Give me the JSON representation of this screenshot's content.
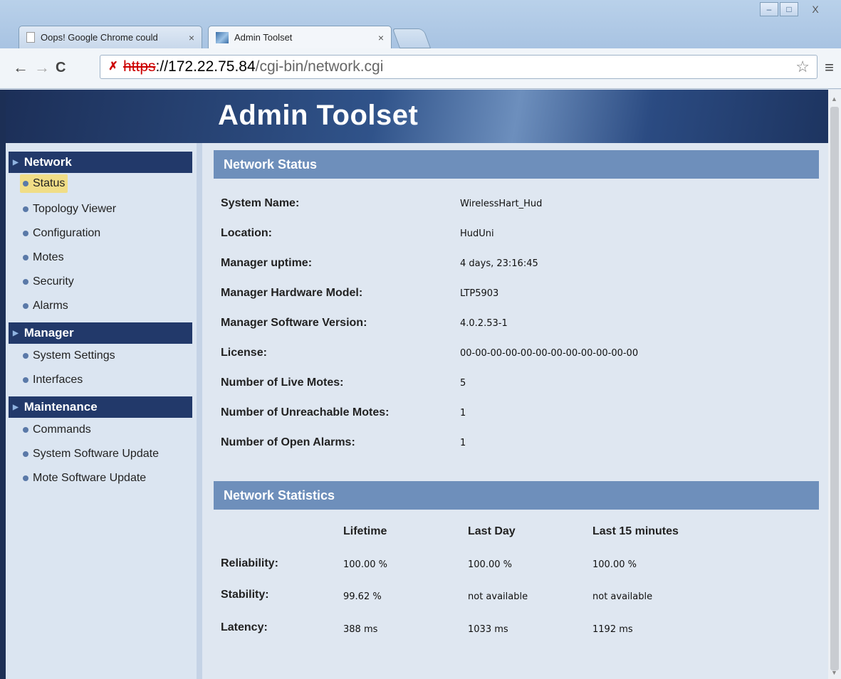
{
  "browser": {
    "tabs": [
      {
        "title": "Oops! Google Chrome could",
        "close": "×"
      },
      {
        "title": "Admin Toolset",
        "close": "×"
      }
    ],
    "window_buttons": {
      "minimize": "–",
      "maximize": "□",
      "close": "X"
    },
    "url": {
      "scheme": "https",
      "rest_host": "://172.22.75.84",
      "path": "/cgi-bin/network.cgi"
    }
  },
  "header": {
    "title": "Admin Toolset"
  },
  "sidebar": {
    "sections": [
      {
        "title": "Network",
        "items": [
          "Status",
          "Topology Viewer",
          "Configuration",
          "Motes",
          "Security",
          "Alarms"
        ]
      },
      {
        "title": "Manager",
        "items": [
          "System Settings",
          "Interfaces"
        ]
      },
      {
        "title": "Maintenance",
        "items": [
          "Commands",
          "System Software Update",
          "Mote Software Update"
        ]
      }
    ],
    "active_item": "Status"
  },
  "status_panel": {
    "title": "Network Status",
    "rows": [
      {
        "label": "System Name:",
        "value": "WirelessHart_Hud"
      },
      {
        "label": "Location:",
        "value": "HudUni"
      },
      {
        "label": "Manager uptime:",
        "value": "4 days, 23:16:45"
      },
      {
        "label": "Manager Hardware Model:",
        "value": "LTP5903"
      },
      {
        "label": "Manager Software Version:",
        "value": "4.0.2.53-1"
      },
      {
        "label": "License:",
        "value": "00-00-00-00-00-00-00-00-00-00-00-00"
      },
      {
        "label": "Number of Live Motes:",
        "value": "5"
      },
      {
        "label": "Number of Unreachable Motes:",
        "value": "1"
      },
      {
        "label": "Number of Open Alarms:",
        "value": "1"
      }
    ]
  },
  "stats_panel": {
    "title": "Network Statistics",
    "columns": [
      "Lifetime",
      "Last Day",
      "Last 15 minutes"
    ],
    "rows": [
      {
        "label": "Reliability:",
        "values": [
          "100.00 %",
          "100.00 %",
          "100.00 %"
        ]
      },
      {
        "label": "Stability:",
        "values": [
          "99.62 %",
          "not available",
          "not available"
        ]
      },
      {
        "label": "Latency:",
        "values": [
          "388 ms",
          "1033 ms",
          "1192 ms"
        ]
      }
    ]
  }
}
